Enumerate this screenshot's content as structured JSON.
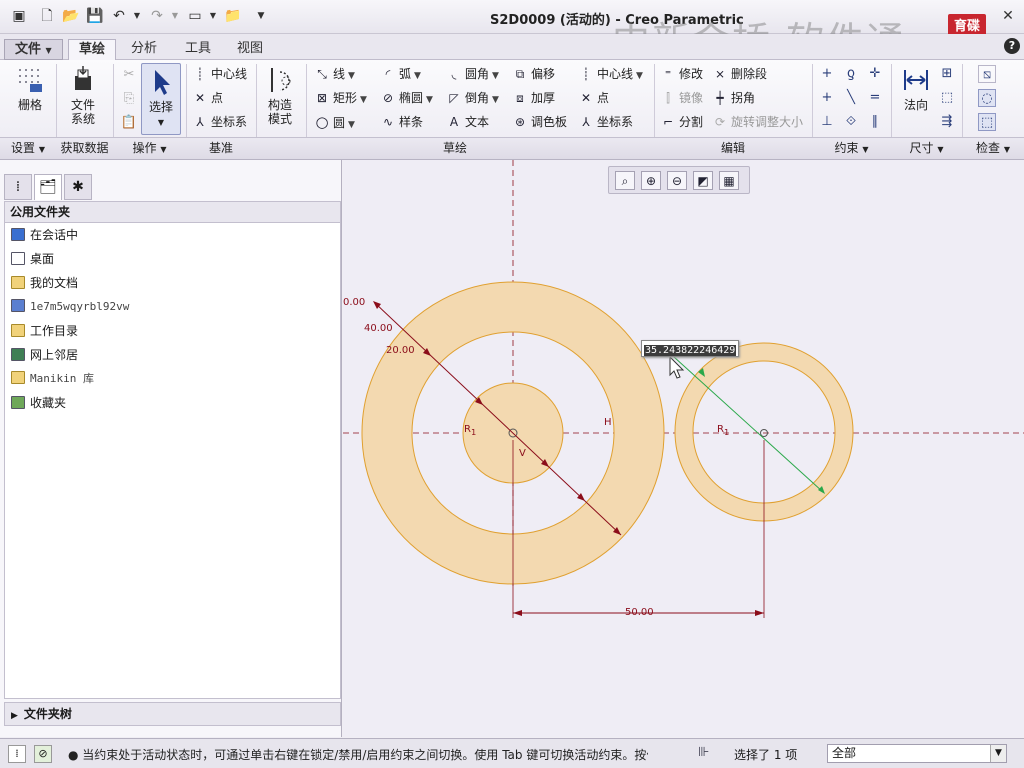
{
  "window": {
    "title": "S2D0009 (活动的) - Creo Parametric"
  },
  "watermark": {
    "text": "中新金桥 软件通",
    "logo": "育碟软件"
  },
  "tabs": {
    "file": "文件",
    "sketch": "草绘",
    "analysis": "分析",
    "tools": "工具",
    "view": "视图"
  },
  "ribbon": {
    "grid": "栅格",
    "file_system": [
      "文件",
      "系统"
    ],
    "select": "选择",
    "construct_mode": [
      "构造",
      "模式"
    ],
    "datum": {
      "centerline": "中心线",
      "point": "点",
      "coord_sys": "坐标系"
    },
    "sketch": {
      "line": "线",
      "arc": "弧",
      "fillet": "圆角",
      "offset": "偏移",
      "rectangle": "矩形",
      "ellipse": "椭圆",
      "chamfer": "倒角",
      "thicken": "加厚",
      "circle": "圆",
      "spline": "样条",
      "text": "文本",
      "palette": "调色板",
      "centerline": "中心线",
      "point": "点",
      "coord_sys": "坐标系"
    },
    "edit": {
      "modify": "修改",
      "delete_segment": "删除段",
      "mirror": "镜像",
      "corner": "拐角",
      "divide": "分割",
      "rotate_resize": "旋转调整大小"
    },
    "normal": "法向",
    "groups": {
      "setup": "设置",
      "get_data": "获取数据",
      "operations": "操作",
      "datum": "基准",
      "sketching": "草绘",
      "editing": "编辑",
      "constrain": "约束",
      "dimension": "尺寸",
      "inspect": "检查"
    }
  },
  "left_panel": {
    "header": "公用文件夹",
    "items": [
      {
        "label": "在会话中",
        "icon": "session-icon"
      },
      {
        "label": "桌面",
        "icon": "desktop-icon"
      },
      {
        "label": "我的文档",
        "icon": "documents-icon"
      },
      {
        "label": "1e7m5wqyrbl92vw",
        "icon": "computer-icon"
      },
      {
        "label": "工作目录",
        "icon": "working-dir-icon"
      },
      {
        "label": "网上邻居",
        "icon": "network-icon"
      },
      {
        "label": "Manikin 库",
        "icon": "manikin-icon"
      },
      {
        "label": "收藏夹",
        "icon": "favorites-icon"
      }
    ],
    "footer": "文件夹树"
  },
  "sketch": {
    "dim_left_top": "0.00",
    "dim_40": "40.00",
    "dim_20": "20.00",
    "dim_50": "50.00",
    "active_input": "35.243822246429",
    "label_h": "H",
    "label_v": "V",
    "label_r1_left": "R",
    "label_r1_left_sub": "1",
    "label_r1_right": "R",
    "label_r1_right_sub": "1",
    "colors": {
      "fill": "#f3d9b0",
      "edge": "#e0a030",
      "dim": "#8b0d1a",
      "active": "#2aa84a"
    }
  },
  "status": {
    "message": "● 当约束处于活动状态时，可通过单击右键在锁定/禁用/启用约束之间切换。使用 Tab 键可切换活动约束。按住 Shift",
    "selected": "选择了 1 项",
    "filter": "全部"
  }
}
